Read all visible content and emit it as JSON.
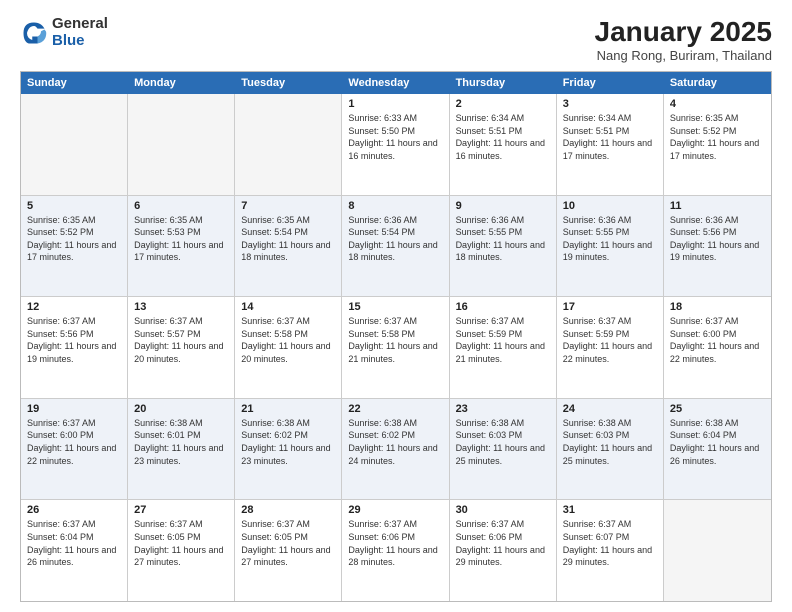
{
  "logo": {
    "general": "General",
    "blue": "Blue"
  },
  "header": {
    "title": "January 2025",
    "subtitle": "Nang Rong, Buriram, Thailand"
  },
  "days": [
    "Sunday",
    "Monday",
    "Tuesday",
    "Wednesday",
    "Thursday",
    "Friday",
    "Saturday"
  ],
  "weeks": [
    [
      {
        "day": "",
        "empty": true
      },
      {
        "day": "",
        "empty": true
      },
      {
        "day": "",
        "empty": true
      },
      {
        "day": "1",
        "sunrise": "Sunrise: 6:33 AM",
        "sunset": "Sunset: 5:50 PM",
        "daylight": "Daylight: 11 hours and 16 minutes."
      },
      {
        "day": "2",
        "sunrise": "Sunrise: 6:34 AM",
        "sunset": "Sunset: 5:51 PM",
        "daylight": "Daylight: 11 hours and 16 minutes."
      },
      {
        "day": "3",
        "sunrise": "Sunrise: 6:34 AM",
        "sunset": "Sunset: 5:51 PM",
        "daylight": "Daylight: 11 hours and 17 minutes."
      },
      {
        "day": "4",
        "sunrise": "Sunrise: 6:35 AM",
        "sunset": "Sunset: 5:52 PM",
        "daylight": "Daylight: 11 hours and 17 minutes."
      }
    ],
    [
      {
        "day": "5",
        "sunrise": "Sunrise: 6:35 AM",
        "sunset": "Sunset: 5:52 PM",
        "daylight": "Daylight: 11 hours and 17 minutes."
      },
      {
        "day": "6",
        "sunrise": "Sunrise: 6:35 AM",
        "sunset": "Sunset: 5:53 PM",
        "daylight": "Daylight: 11 hours and 17 minutes."
      },
      {
        "day": "7",
        "sunrise": "Sunrise: 6:35 AM",
        "sunset": "Sunset: 5:54 PM",
        "daylight": "Daylight: 11 hours and 18 minutes."
      },
      {
        "day": "8",
        "sunrise": "Sunrise: 6:36 AM",
        "sunset": "Sunset: 5:54 PM",
        "daylight": "Daylight: 11 hours and 18 minutes."
      },
      {
        "day": "9",
        "sunrise": "Sunrise: 6:36 AM",
        "sunset": "Sunset: 5:55 PM",
        "daylight": "Daylight: 11 hours and 18 minutes."
      },
      {
        "day": "10",
        "sunrise": "Sunrise: 6:36 AM",
        "sunset": "Sunset: 5:55 PM",
        "daylight": "Daylight: 11 hours and 19 minutes."
      },
      {
        "day": "11",
        "sunrise": "Sunrise: 6:36 AM",
        "sunset": "Sunset: 5:56 PM",
        "daylight": "Daylight: 11 hours and 19 minutes."
      }
    ],
    [
      {
        "day": "12",
        "sunrise": "Sunrise: 6:37 AM",
        "sunset": "Sunset: 5:56 PM",
        "daylight": "Daylight: 11 hours and 19 minutes."
      },
      {
        "day": "13",
        "sunrise": "Sunrise: 6:37 AM",
        "sunset": "Sunset: 5:57 PM",
        "daylight": "Daylight: 11 hours and 20 minutes."
      },
      {
        "day": "14",
        "sunrise": "Sunrise: 6:37 AM",
        "sunset": "Sunset: 5:58 PM",
        "daylight": "Daylight: 11 hours and 20 minutes."
      },
      {
        "day": "15",
        "sunrise": "Sunrise: 6:37 AM",
        "sunset": "Sunset: 5:58 PM",
        "daylight": "Daylight: 11 hours and 21 minutes."
      },
      {
        "day": "16",
        "sunrise": "Sunrise: 6:37 AM",
        "sunset": "Sunset: 5:59 PM",
        "daylight": "Daylight: 11 hours and 21 minutes."
      },
      {
        "day": "17",
        "sunrise": "Sunrise: 6:37 AM",
        "sunset": "Sunset: 5:59 PM",
        "daylight": "Daylight: 11 hours and 22 minutes."
      },
      {
        "day": "18",
        "sunrise": "Sunrise: 6:37 AM",
        "sunset": "Sunset: 6:00 PM",
        "daylight": "Daylight: 11 hours and 22 minutes."
      }
    ],
    [
      {
        "day": "19",
        "sunrise": "Sunrise: 6:37 AM",
        "sunset": "Sunset: 6:00 PM",
        "daylight": "Daylight: 11 hours and 22 minutes."
      },
      {
        "day": "20",
        "sunrise": "Sunrise: 6:38 AM",
        "sunset": "Sunset: 6:01 PM",
        "daylight": "Daylight: 11 hours and 23 minutes."
      },
      {
        "day": "21",
        "sunrise": "Sunrise: 6:38 AM",
        "sunset": "Sunset: 6:02 PM",
        "daylight": "Daylight: 11 hours and 23 minutes."
      },
      {
        "day": "22",
        "sunrise": "Sunrise: 6:38 AM",
        "sunset": "Sunset: 6:02 PM",
        "daylight": "Daylight: 11 hours and 24 minutes."
      },
      {
        "day": "23",
        "sunrise": "Sunrise: 6:38 AM",
        "sunset": "Sunset: 6:03 PM",
        "daylight": "Daylight: 11 hours and 25 minutes."
      },
      {
        "day": "24",
        "sunrise": "Sunrise: 6:38 AM",
        "sunset": "Sunset: 6:03 PM",
        "daylight": "Daylight: 11 hours and 25 minutes."
      },
      {
        "day": "25",
        "sunrise": "Sunrise: 6:38 AM",
        "sunset": "Sunset: 6:04 PM",
        "daylight": "Daylight: 11 hours and 26 minutes."
      }
    ],
    [
      {
        "day": "26",
        "sunrise": "Sunrise: 6:37 AM",
        "sunset": "Sunset: 6:04 PM",
        "daylight": "Daylight: 11 hours and 26 minutes."
      },
      {
        "day": "27",
        "sunrise": "Sunrise: 6:37 AM",
        "sunset": "Sunset: 6:05 PM",
        "daylight": "Daylight: 11 hours and 27 minutes."
      },
      {
        "day": "28",
        "sunrise": "Sunrise: 6:37 AM",
        "sunset": "Sunset: 6:05 PM",
        "daylight": "Daylight: 11 hours and 27 minutes."
      },
      {
        "day": "29",
        "sunrise": "Sunrise: 6:37 AM",
        "sunset": "Sunset: 6:06 PM",
        "daylight": "Daylight: 11 hours and 28 minutes."
      },
      {
        "day": "30",
        "sunrise": "Sunrise: 6:37 AM",
        "sunset": "Sunset: 6:06 PM",
        "daylight": "Daylight: 11 hours and 29 minutes."
      },
      {
        "day": "31",
        "sunrise": "Sunrise: 6:37 AM",
        "sunset": "Sunset: 6:07 PM",
        "daylight": "Daylight: 11 hours and 29 minutes."
      },
      {
        "day": "",
        "empty": true
      }
    ]
  ]
}
